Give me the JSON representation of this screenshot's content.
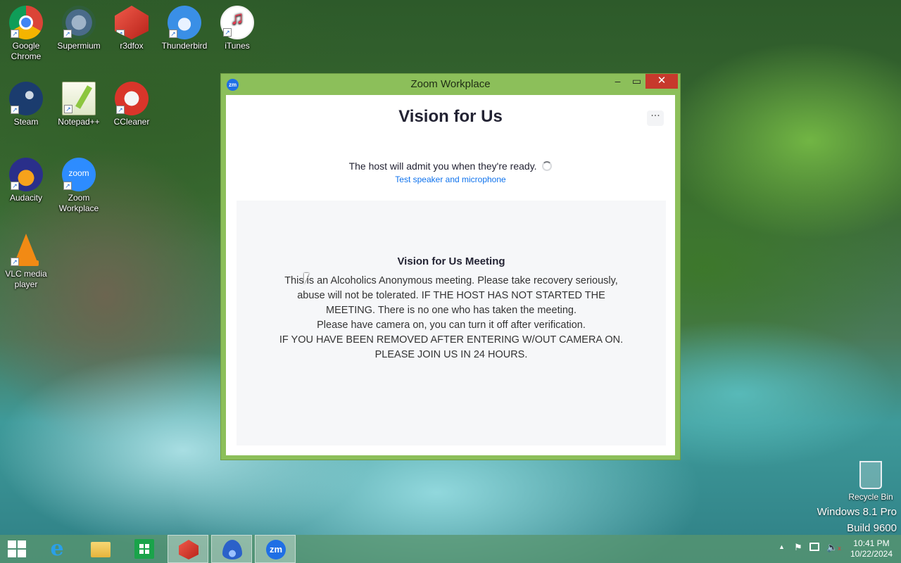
{
  "desktop": {
    "icons": [
      {
        "label": "Google Chrome"
      },
      {
        "label": "Supermium"
      },
      {
        "label": "r3dfox"
      },
      {
        "label": "Thunderbird"
      },
      {
        "label": "iTunes"
      },
      {
        "label": "Steam"
      },
      {
        "label": "Notepad++"
      },
      {
        "label": "CCleaner"
      },
      {
        "label": "Audacity"
      },
      {
        "label": "Zoom Workplace"
      },
      {
        "label": "VLC media player"
      }
    ],
    "recycle_bin": "Recycle Bin",
    "watermark": {
      "line1": "Windows 8.1 Pro",
      "line2": "Build 9600"
    }
  },
  "window": {
    "title": "Zoom Workplace",
    "app_icon_text": "zm",
    "meeting_title": "Vision for Us",
    "more_label": "···",
    "wait_message": "The host will admit you when they're ready.",
    "test_link": "Test speaker and microphone",
    "description": {
      "title": "Vision for Us Meeting",
      "lines": [
        "This is an Alcoholics Anonymous meeting. Please take recovery seriously,",
        "abuse will not be tolerated. IF THE HOST HAS NOT STARTED THE",
        "MEETING. There is no one who has taken the meeting.",
        "Please have camera on, you can turn it off after verification.",
        "IF YOU HAVE BEEN REMOVED AFTER ENTERING W/OUT CAMERA ON.",
        "PLEASE JOIN US IN 24 HOURS."
      ]
    }
  },
  "taskbar": {
    "zoom_icon_text": "zm",
    "time": "10:41 PM",
    "date": "10/22/2024"
  },
  "colors": {
    "window_frame": "#8cbf5a",
    "close_button": "#c7392c",
    "zoom_blue": "#0e72ed"
  }
}
